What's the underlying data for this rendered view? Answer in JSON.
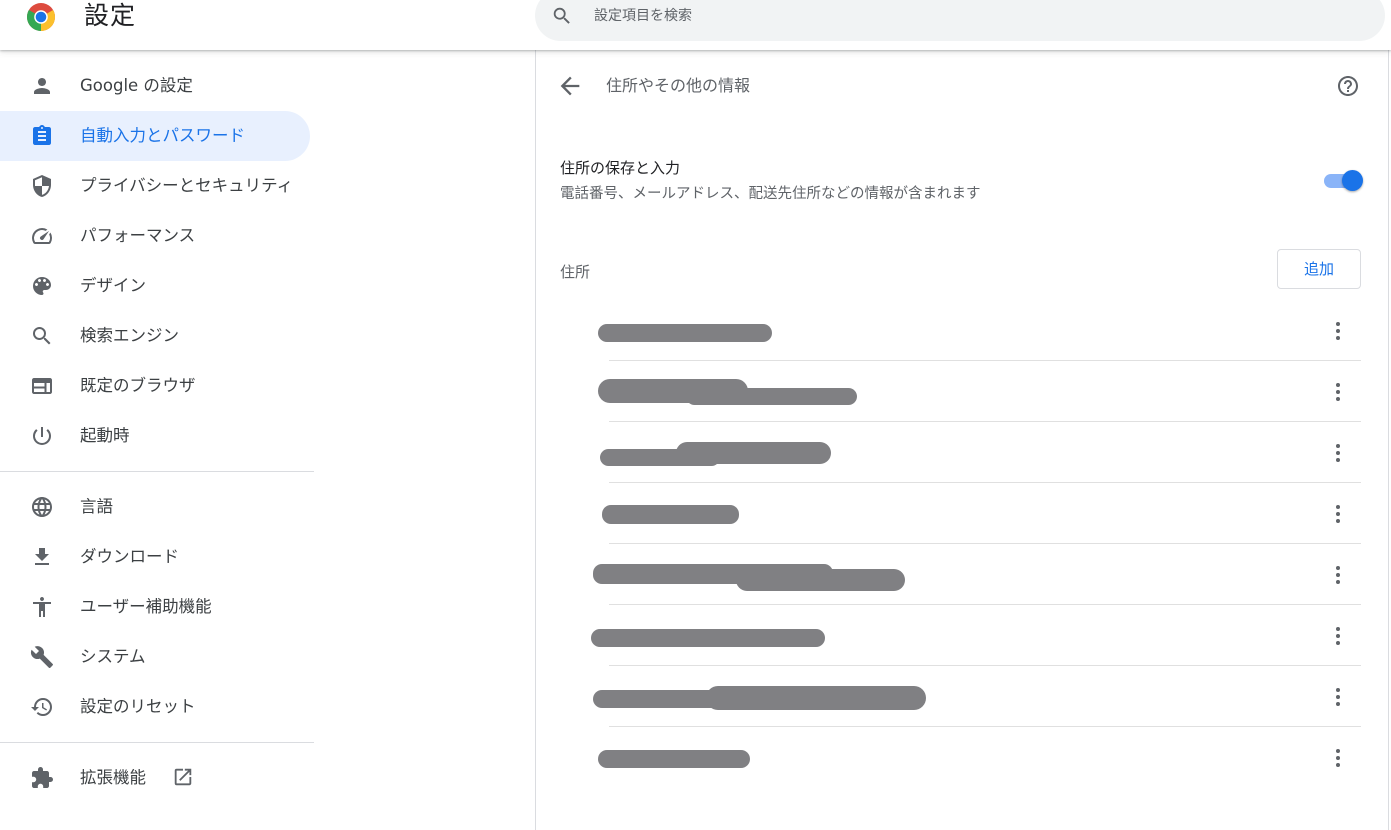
{
  "app": {
    "title": "設定"
  },
  "search": {
    "placeholder": "設定項目を検索",
    "icon": "search-icon"
  },
  "sidebar": {
    "items": [
      {
        "label": "Google の設定",
        "icon": "person-icon",
        "active": false
      },
      {
        "label": "自動入力とパスワード",
        "icon": "clipboard-icon",
        "active": true
      },
      {
        "label": "プライバシーとセキュリティ",
        "icon": "shield-icon",
        "active": false
      },
      {
        "label": "パフォーマンス",
        "icon": "speedometer-icon",
        "active": false
      },
      {
        "label": "デザイン",
        "icon": "palette-icon",
        "active": false
      },
      {
        "label": "検索エンジン",
        "icon": "search-icon",
        "active": false
      },
      {
        "label": "既定のブラウザ",
        "icon": "browser-window-icon",
        "active": false
      },
      {
        "label": "起動時",
        "icon": "power-icon",
        "active": false
      },
      {
        "label": "言語",
        "icon": "globe-icon",
        "active": false
      },
      {
        "label": "ダウンロード",
        "icon": "download-icon",
        "active": false
      },
      {
        "label": "ユーザー補助機能",
        "icon": "accessibility-icon",
        "active": false
      },
      {
        "label": "システム",
        "icon": "wrench-icon",
        "active": false
      },
      {
        "label": "設定のリセット",
        "icon": "restore-icon",
        "active": false
      },
      {
        "label": "拡張機能",
        "icon": "puzzle-icon",
        "active": false
      }
    ]
  },
  "main": {
    "subpage_title": "住所やその他の情報",
    "toggle": {
      "title": "住所の保存と入力",
      "description": "電話番号、メールアドレス、配送先住所などの情報が含まれます",
      "enabled": true
    },
    "addresses_label": "住所",
    "add_label": "追加",
    "addresses_count": 8
  },
  "colors": {
    "accent": "#1a73e8",
    "active_nav_bg": "#e8f0fe",
    "redaction": "#808083",
    "text_secondary": "#5f6368"
  }
}
